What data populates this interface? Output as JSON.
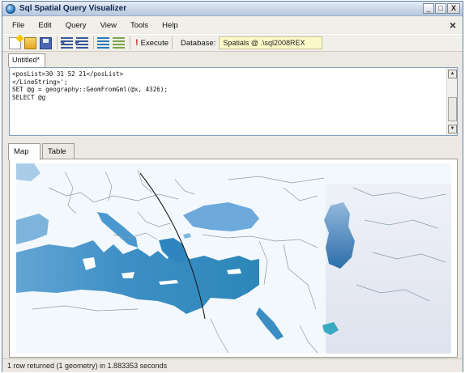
{
  "window": {
    "title": "Sql Spatial Query Visualizer",
    "minimize": "_",
    "maximize": "□",
    "close": "X"
  },
  "menu": {
    "items": [
      "File",
      "Edit",
      "Query",
      "View",
      "Tools",
      "Help"
    ],
    "close_glyph": "×"
  },
  "toolbar": {
    "execute_label": "Execute",
    "execute_icon": "!",
    "database_label": "Database:",
    "database_value": "Spatials @ .\\sql2008REX"
  },
  "document_tab": {
    "label": "Untitled*"
  },
  "editor": {
    "lines": [
      "<posList>30 31 52 21</posList>",
      "</LineString>';",
      "SET @g = geography::GeomFromGml(@x, 4326);",
      "SELECT @g"
    ]
  },
  "result_tabs": {
    "map": "Map",
    "table": "Table"
  },
  "colors": {
    "window_border": "#5f7fa8",
    "selection": "#fdf8c8",
    "sea": "#3a8fc8",
    "land": "#ffffff",
    "route": "#111111"
  },
  "status": {
    "text": "1 row returned (1 geometry) in 1.883353 seconds"
  }
}
